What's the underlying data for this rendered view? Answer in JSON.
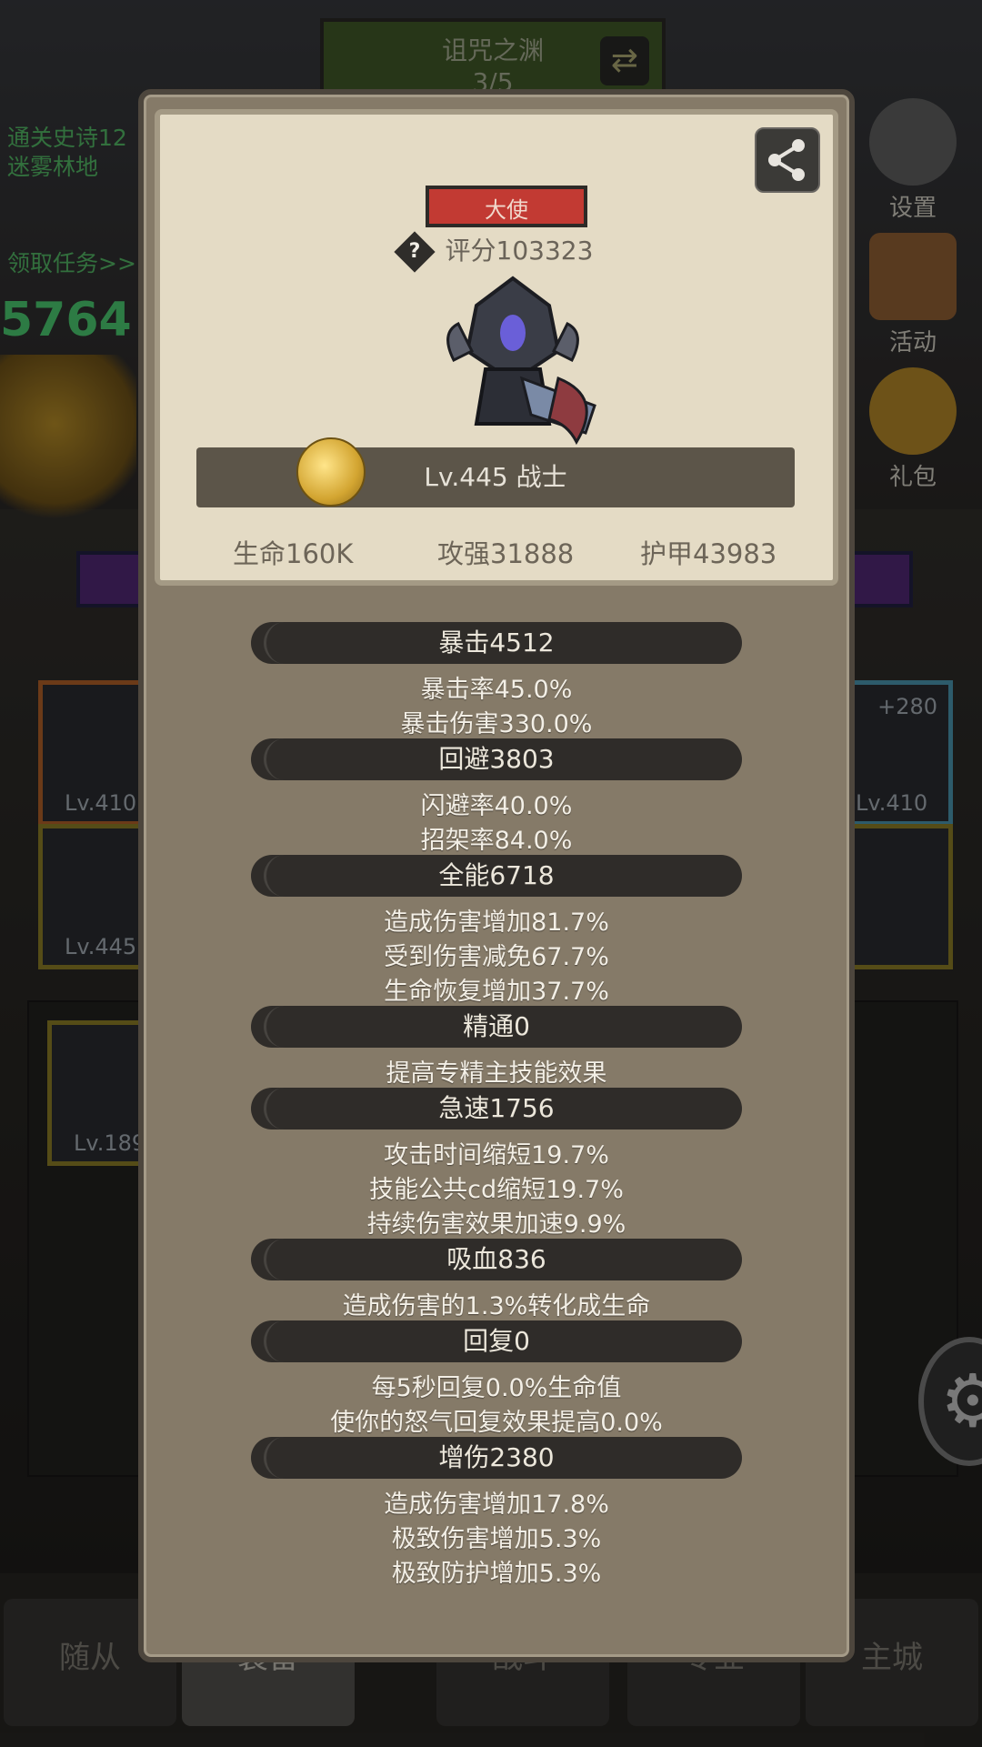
{
  "background": {
    "dungeon_title": "诅咒之渊",
    "dungeon_progress": "3/5",
    "quest_line1": "通关史诗12",
    "quest_line2": "迷雾林地",
    "quest_link": "领取任务>>",
    "side_buttons": [
      "设置",
      "活动",
      "礼包"
    ],
    "equip_levels": [
      "Lv.410",
      "Lv.410",
      "Lv.445",
      "Lv.189"
    ],
    "equip_plus": "+280",
    "nav_tabs": [
      "随从",
      "装备",
      "战斗",
      "专业",
      "主城"
    ]
  },
  "card": {
    "role_badge": "大使",
    "score": "评分103323",
    "level_label": "Lv.445 战士",
    "hp": "生命160K",
    "attack": "攻强31888",
    "armor": "护甲43983"
  },
  "sections": [
    {
      "header": "暴击4512",
      "lines": [
        "暴击率45.0%",
        "暴击伤害330.0%"
      ]
    },
    {
      "header": "回避3803",
      "lines": [
        "闪避率40.0%",
        "招架率84.0%"
      ]
    },
    {
      "header": "全能6718",
      "lines": [
        "造成伤害增加81.7%",
        "受到伤害减免67.7%",
        "生命恢复增加37.7%"
      ]
    },
    {
      "header": "精通0",
      "lines": [
        "提高专精主技能效果"
      ]
    },
    {
      "header": "急速1756",
      "lines": [
        "攻击时间缩短19.7%",
        "技能公共cd缩短19.7%",
        "持续伤害效果加速9.9%"
      ]
    },
    {
      "header": "吸血836",
      "lines": [
        "造成伤害的1.3%转化成生命"
      ]
    },
    {
      "header": "回复0",
      "lines": [
        "每5秒回复0.0%生命值",
        "使你的怒气回复效果提高0.0%"
      ]
    },
    {
      "header": "增伤2380",
      "lines": [
        "造成伤害增加17.8%",
        "极致伤害增加5.3%",
        "极致防护增加5.3%"
      ]
    }
  ]
}
